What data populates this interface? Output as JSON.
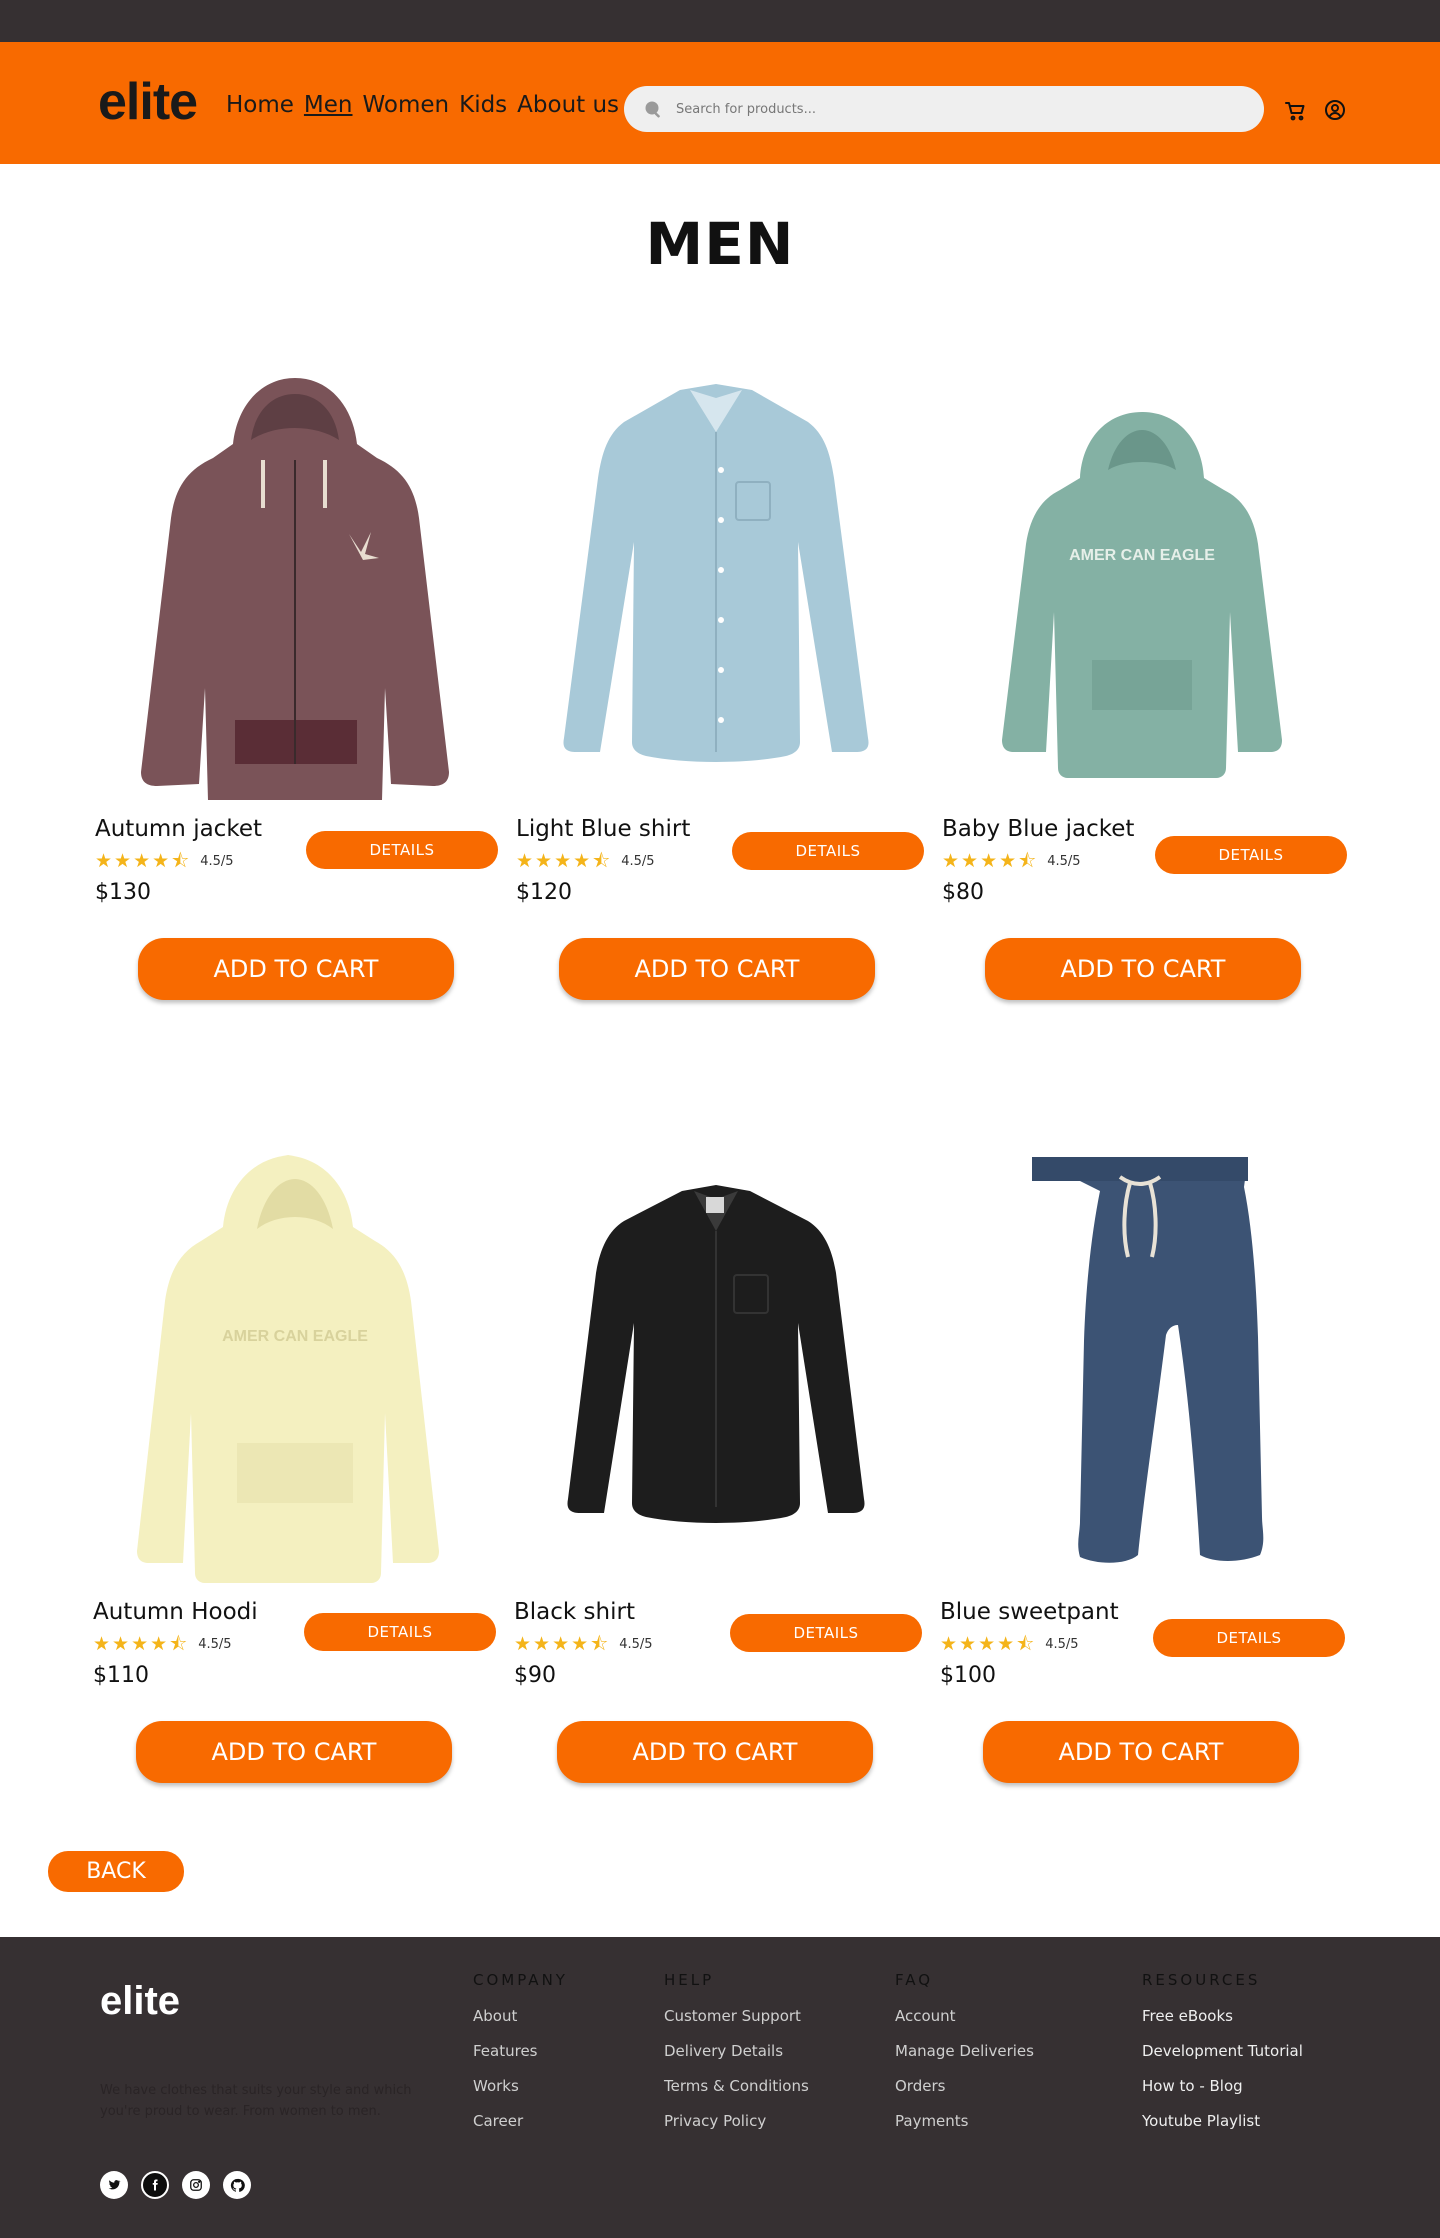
{
  "header": {
    "logo": "elite",
    "nav": [
      "Home",
      "Men",
      "Women",
      "Kids",
      "About us"
    ],
    "active_nav": "Men",
    "search_placeholder": "Search for products..."
  },
  "page": {
    "title": "MEN"
  },
  "products": [
    {
      "name": "Autumn jacket",
      "rating": "4.5/5",
      "price": "$130",
      "details": "DETAILS",
      "add": "ADD TO CART"
    },
    {
      "name": "Light Blue shirt",
      "rating": "4.5/5",
      "price": "$120",
      "details": "DETAILS",
      "add": "ADD TO CART"
    },
    {
      "name": "Baby Blue jacket",
      "rating": "4.5/5",
      "price": "$80",
      "details": "DETAILS",
      "add": "ADD TO CART"
    },
    {
      "name": "Autumn Hoodi",
      "rating": "4.5/5",
      "price": "$110",
      "details": "DETAILS",
      "add": "ADD TO CART"
    },
    {
      "name": "Black shirt",
      "rating": "4.5/5",
      "price": "$90",
      "details": "DETAILS",
      "add": "ADD TO CART"
    },
    {
      "name": "Blue sweetpant",
      "rating": "4.5/5",
      "price": "$100",
      "details": "DETAILS",
      "add": "ADD TO CART"
    }
  ],
  "back_label": "BACK",
  "footer": {
    "logo": "elite",
    "tagline": "We have clothes that suits your style and which you're proud to wear. From women to men.",
    "columns": [
      {
        "title": "COMPANY",
        "links": [
          "About",
          "Features",
          "Works",
          "Career"
        ]
      },
      {
        "title": "HELP",
        "links": [
          "Customer Support",
          "Delivery Details",
          "Terms & Conditions",
          "Privacy Policy"
        ]
      },
      {
        "title": "FAQ",
        "links": [
          "Account",
          "Manage Deliveries",
          "Orders",
          "Payments"
        ]
      },
      {
        "title": "RESOURCES",
        "links": [
          "Free eBooks",
          "Development Tutorial",
          "How to - Blog",
          "Youtube Playlist"
        ]
      }
    ],
    "socials": [
      "twitter-icon",
      "facebook-icon",
      "instagram-icon",
      "github-icon"
    ]
  },
  "colors": {
    "brand": "#f86a00",
    "dark": "#363032",
    "star": "#f4b41a"
  }
}
